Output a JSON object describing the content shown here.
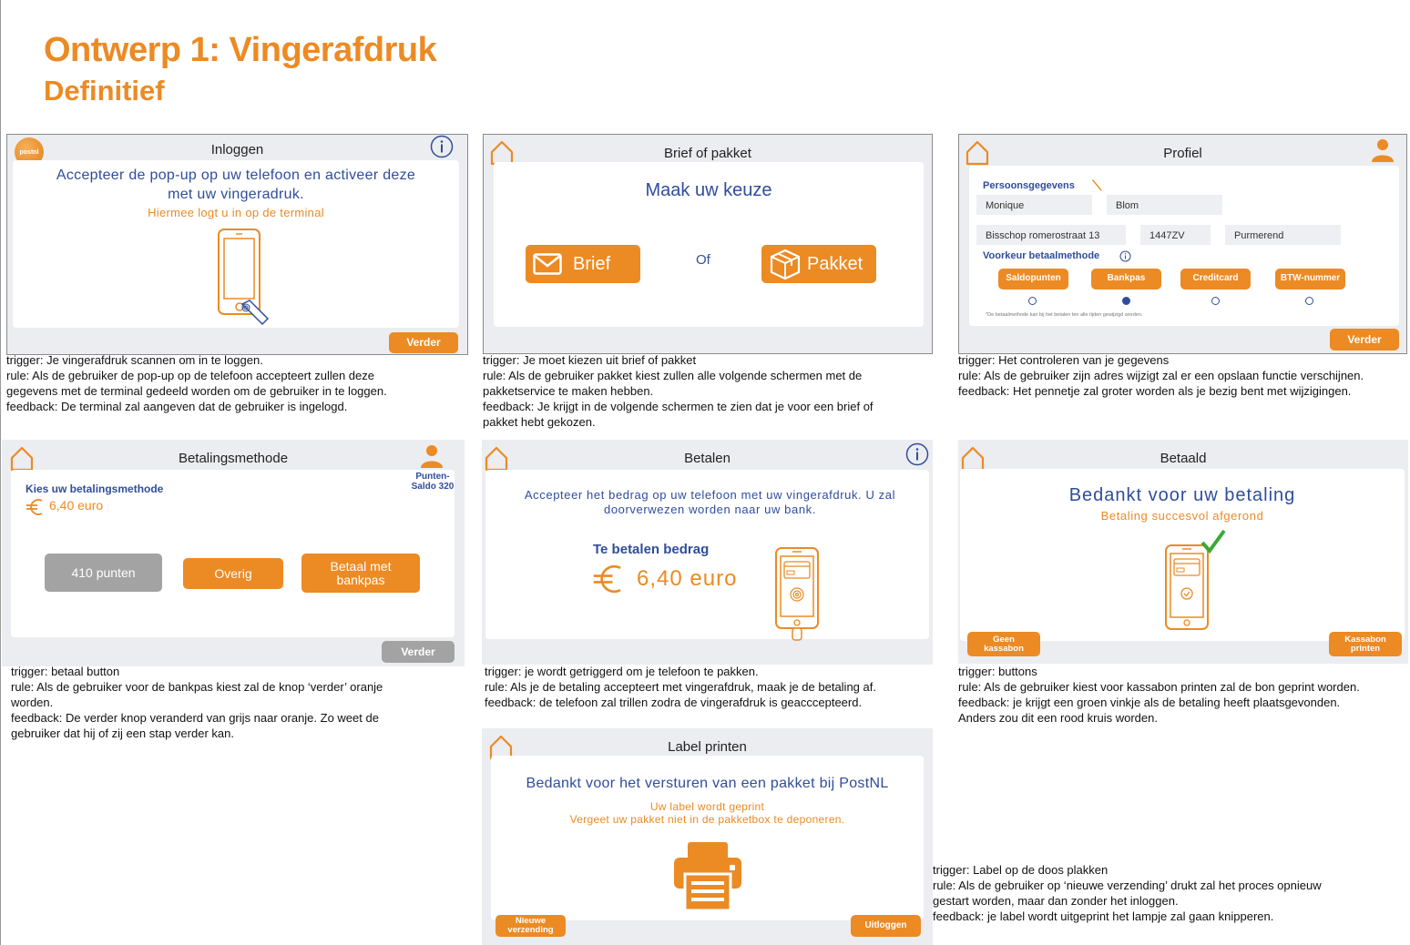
{
  "header": {
    "title": "Ontwerp 1: Vingerafdruk",
    "subtitle": "Definitief"
  },
  "screens": {
    "inloggen": {
      "title": "Inloggen",
      "logo_text": "postnl",
      "main_text": "Accepteer de pop-up op uw telefoon en activeer deze met uw vingeradruk.",
      "sub_text": "Hiermee logt u in op de terminal",
      "button": "Verder",
      "info_icon": "info-icon",
      "note": [
        "trigger: Je vingerafdruk scannen om in te loggen.",
        "rule: Als de gebruiker de pop-up op de telefoon accepteert zullen deze",
        "gegevens met de terminal gedeeld worden om de gebruiker in te loggen.",
        "feedback: De terminal zal aangeven dat de gebruiker is ingelogd."
      ]
    },
    "brief": {
      "title": "Brief of pakket",
      "heading": "Maak uw keuze",
      "btn_brief": "Brief",
      "or": "Of",
      "btn_pakket": "Pakket",
      "note": [
        "trigger: Je moet kiezen uit brief of pakket",
        "rule: Als de gebruiker pakket kiest zullen alle volgende schermen met de",
        "pakketservice te maken hebben.",
        "feedback: Je krijgt in de volgende schermen te zien dat je voor een brief of",
        "pakket hebt gekozen."
      ]
    },
    "profiel": {
      "title": "Profiel",
      "section1": "Persoonsgegevens",
      "first_name": "Monique",
      "last_name": "Blom",
      "street": "Bisschop romerostraat 13",
      "postcode": "1447ZV",
      "city": "Purmerend",
      "section2": "Voorkeur betaalmethode",
      "options": [
        "Saldopunten",
        "Bankpas",
        "Creditcard",
        "BTW-nummer"
      ],
      "selected_option": "Bankpas",
      "footnote": "*De betaalmethode kan bij het betalen ten alle tijden gewijzigd worden.",
      "button": "Verder",
      "note": [
        "trigger: Het controleren van je gegevens",
        "rule: Als de gebruiker zijn adres wijzigt zal er een opslaan functie verschijnen.",
        "feedback: Het pennetje zal groter worden als je bezig bent met wijzigingen."
      ]
    },
    "betalingsmethode": {
      "title": "Betalingsmethode",
      "points_label_1": "Punten-",
      "points_label_2": "Saldo 320",
      "heading": "Kies uw betalingsmethode",
      "amount": "6,40 euro",
      "btn_points": "410 punten",
      "btn_other": "Overig",
      "btn_bank_1": "Betaal met",
      "btn_bank_2": "bankpas",
      "button": "Verder",
      "note": [
        "trigger: betaal button",
        "rule: Als de gebruiker voor de bankpas kiest zal de knop ‘verder’ oranje",
        "worden.",
        "feedback: De verder knop veranderd van grijs naar oranje. Zo weet de",
        "gebruiker dat hij of zij een stap verder kan."
      ]
    },
    "betalen": {
      "title": "Betalen",
      "instruction": "Accepteer het bedrag op uw telefoon met uw vingerafdruk. U zal doorverwezen worden naar uw bank.",
      "label": "Te betalen bedrag",
      "amount": "6,40 euro",
      "note": [
        "trigger: je wordt getriggerd om je telefoon te pakken.",
        "rule: Als je de betaling accepteert met vingerafdruk, maak je de betaling af.",
        "feedback: de telefoon zal trillen zodra de vingerafdruk is geacccepteerd."
      ]
    },
    "betaald": {
      "title": "Betaald",
      "heading": "Bedankt voor uw betaling",
      "sub": "Betaling succesvol afgerond",
      "btn_left_1": "Geen",
      "btn_left_2": "kassabon",
      "btn_right_1": "Kassabon",
      "btn_right_2": "printen",
      "note": [
        "trigger: buttons",
        "rule: Als de gebruiker kiest voor kassabon printen zal de bon geprint worden.",
        "feedback: je krijgt een groen vinkje als de betaling heeft plaatsgevonden.",
        "Anders zou dit een rood kruis worden."
      ]
    },
    "label": {
      "title": "Label printen",
      "heading": "Bedankt voor het versturen van een pakket bij PostNL",
      "sub1": "Uw label wordt geprint",
      "sub2": "Vergeet uw pakket niet in de pakketbox te deponeren.",
      "btn_left_1": "Nieuwe",
      "btn_left_2": "verzending",
      "btn_right": "Uitloggen",
      "note": [
        "trigger: Label op de doos plakken",
        "rule: Als de gebruiker op ‘nieuwe verzending’ drukt zal het proces opnieuw",
        "gestart worden, maar dan zonder het inloggen.",
        "feedback: je label wordt uitgeprint het lampje zal gaan knipperen."
      ]
    }
  },
  "colors": {
    "accent": "#ec8a24",
    "blue": "#2f4d9c",
    "panel_bg": "#ecedf0",
    "disabled": "#a3a3a3",
    "check": "#3aa935"
  }
}
